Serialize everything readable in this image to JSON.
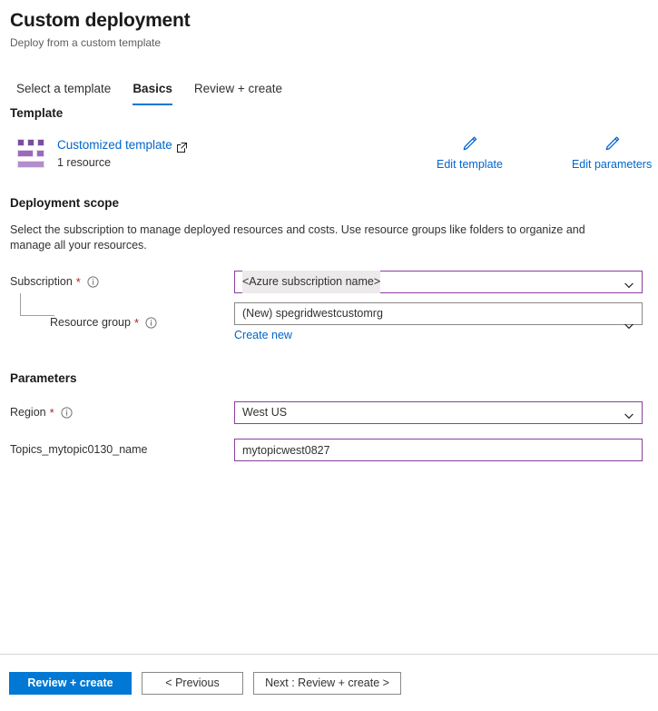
{
  "header": {
    "title": "Custom deployment",
    "subtitle": "Deploy from a custom template"
  },
  "tabs": [
    {
      "label": "Select a template",
      "active": false
    },
    {
      "label": "Basics",
      "active": true
    },
    {
      "label": "Review + create",
      "active": false
    }
  ],
  "template": {
    "section_title": "Template",
    "icon": "template-grid-icon",
    "link_label": "Customized template",
    "external_icon": "external-link-icon",
    "resource_count": "1 resource",
    "actions": [
      {
        "icon": "pencil-icon",
        "label": "Edit template"
      },
      {
        "icon": "pencil-icon",
        "label": "Edit parameters"
      }
    ]
  },
  "scope": {
    "section_title": "Deployment scope",
    "description": "Select the subscription to manage deployed resources and costs. Use resource groups like folders to organize and manage all your resources.",
    "subscription": {
      "label": "Subscription",
      "required": "*",
      "info_icon": "info-icon",
      "value": "<Azure subscription name>",
      "chevron_icon": "chevron-down-icon"
    },
    "resource_group": {
      "label": "Resource group",
      "required": "*",
      "info_icon": "info-icon",
      "value": "(New) spegridwestcustomrg",
      "chevron_icon": "chevron-down-icon",
      "create_new_label": "Create new"
    }
  },
  "parameters": {
    "section_title": "Parameters",
    "region": {
      "label": "Region",
      "required": "*",
      "info_icon": "info-icon",
      "value": "West US",
      "chevron_icon": "chevron-down-icon"
    },
    "topic_name": {
      "label": "Topics_mytopic0130_name",
      "value": "mytopicwest0827",
      "placeholder": ""
    }
  },
  "footer": {
    "review_create": "Review + create",
    "previous": "< Previous",
    "next": "Next : Review + create >"
  },
  "colors": {
    "accent_blue": "#0078d4",
    "link_blue": "#0066cc",
    "field_border_purple": "#8a3fa0",
    "field_border_gray": "#8a8886",
    "required_red": "#a4262c",
    "template_icon_purple": "#7a4e9e"
  }
}
